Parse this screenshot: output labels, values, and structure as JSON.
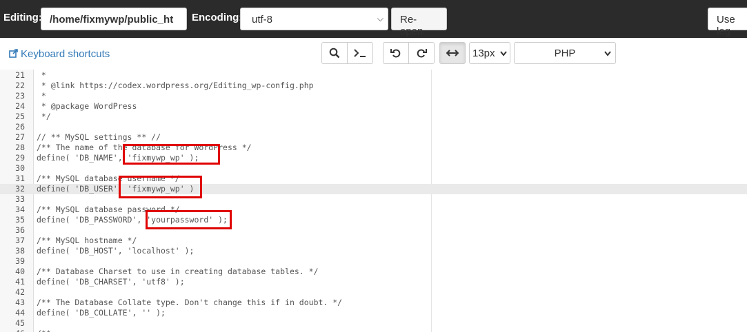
{
  "topbar": {
    "editing_label": "Editing:",
    "path_value": "/home/fixmywp/public_ht",
    "encoding_label": "Encoding:",
    "encoding_value": "utf-8",
    "reopen_label": "Re-open",
    "legacy_label": "Use leg"
  },
  "toolbar": {
    "keyboard_shortcuts": "Keyboard shortcuts",
    "font_size": "13px",
    "mode": "PHP"
  },
  "editor": {
    "active_line": 32,
    "lines": [
      {
        "n": "21",
        "text": " *"
      },
      {
        "n": "22",
        "text": " * @link https://codex.wordpress.org/Editing_wp-config.php"
      },
      {
        "n": "23",
        "text": " *"
      },
      {
        "n": "24",
        "text": " * @package WordPress"
      },
      {
        "n": "25",
        "text": " */"
      },
      {
        "n": "26",
        "text": ""
      },
      {
        "n": "27",
        "text": "// ** MySQL settings ** //"
      },
      {
        "n": "28",
        "text": "/** The name of the database for WordPress */"
      },
      {
        "n": "29",
        "text": "define( 'DB_NAME', 'fixmywp_wp' );"
      },
      {
        "n": "30",
        "text": ""
      },
      {
        "n": "31",
        "text": "/** MySQL database username */"
      },
      {
        "n": "32",
        "text": "define( 'DB_USER', 'fixmywp_wp' )"
      },
      {
        "n": "33",
        "text": ""
      },
      {
        "n": "34",
        "text": "/** MySQL database password */"
      },
      {
        "n": "35",
        "text": "define( 'DB_PASSWORD', 'yourpassword' );"
      },
      {
        "n": "36",
        "text": ""
      },
      {
        "n": "37",
        "text": "/** MySQL hostname */"
      },
      {
        "n": "38",
        "text": "define( 'DB_HOST', 'localhost' );"
      },
      {
        "n": "39",
        "text": ""
      },
      {
        "n": "40",
        "text": "/** Database Charset to use in creating database tables. */"
      },
      {
        "n": "41",
        "text": "define( 'DB_CHARSET', 'utf8' );"
      },
      {
        "n": "42",
        "text": ""
      },
      {
        "n": "43",
        "text": "/** The Database Collate type. Don't change this if in doubt. */"
      },
      {
        "n": "44",
        "text": "define( 'DB_COLLATE', '' );"
      },
      {
        "n": "45",
        "text": ""
      },
      {
        "n": "46",
        "text": "/**"
      }
    ]
  },
  "annotations": {
    "highlight_color": "#e00000"
  }
}
